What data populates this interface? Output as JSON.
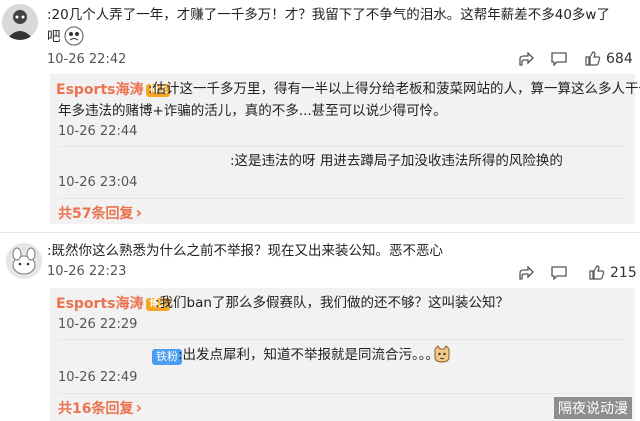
{
  "comment1": {
    "text_line1": ":20几个人弄了一年，才赚了一千多万！才？我留下了不争气的泪水。这帮年薪差不多40多w了",
    "text_line2": "吧",
    "time": "10-26 22:42",
    "like_count": "684"
  },
  "reply1": {
    "author": "Esports海涛",
    "badge": "博主",
    "text_line1": ":估计这一千多万里，得有一半以上得分给老板和菠菜网站的人，算一算这么多人干一",
    "text_line2": "年多违法的赌博+诈骗的活儿，真的不多...甚至可以说少得可怜。",
    "time": "10-26 22:44"
  },
  "reply2": {
    "text": ":这是违法的呀 用进去蹲局子加没收违法所得的风险换的",
    "time": "10-26 23:04"
  },
  "more1": "共57条回复",
  "comment2": {
    "text": ":既然你这么熟悉为什么之前不举报？现在又出来装公知。恶不恶心",
    "time": "10-26 22:23",
    "like_count": "215"
  },
  "reply3": {
    "author": "Esports海涛",
    "badge": "博主",
    "text": ":我们ban了那么多假赛队，我们做的还不够？这叫装公知？",
    "time": "10-26 22:29"
  },
  "reply4": {
    "badge": "铁粉",
    "text": ":出发点犀利，知道不举报就是同流合污。。。",
    "time": "10-26 22:49"
  },
  "more2": "共16条回复",
  "watermark": "隔夜说动漫",
  "colors": {
    "accent": "#eb7350",
    "badge_gold": "#f6a623",
    "badge_blue": "#4a9df0",
    "reply_bg": "#f2f2f2"
  },
  "icons": [
    "avatar-1",
    "avatar-2",
    "share-icon",
    "comment-icon",
    "like-icon",
    "chevron-right-icon",
    "emoji-cat-icon"
  ]
}
